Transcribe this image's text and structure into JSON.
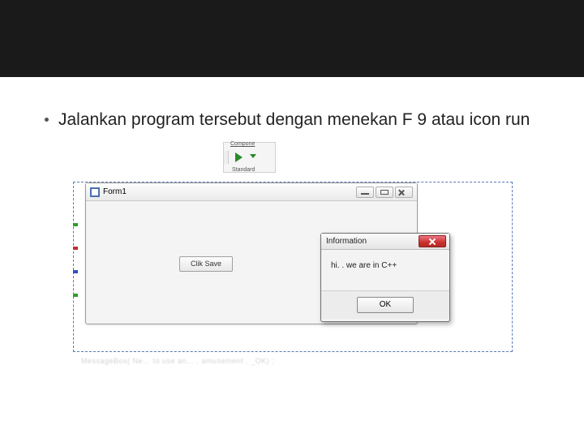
{
  "bullet": {
    "text": "Jalankan program tersebut dengan menekan F 9 atau icon run"
  },
  "toolbar_snippet": {
    "top_label": "Compone",
    "bottom_label": "Standard"
  },
  "form1": {
    "title": "Form1",
    "button_label": "Clik Save"
  },
  "info_dialog": {
    "title": "Information",
    "message": "hi. . we are in C++",
    "ok_label": "OK"
  },
  "bottom_blur": "MessageBox(  Ne…   to  use  an…        ,  amusement  ,   _OK) ;"
}
